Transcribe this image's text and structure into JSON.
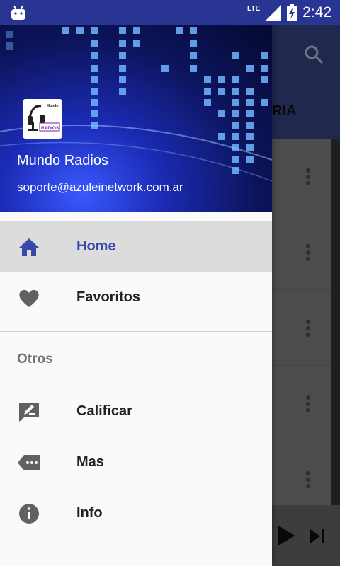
{
  "status_bar": {
    "network": "LTE",
    "time": "2:42"
  },
  "background_app": {
    "tab_fragment": "RIA"
  },
  "drawer": {
    "header": {
      "logo_text_top": "Mundo",
      "logo_text_bottom": "RADIOS",
      "name": "Mundo Radios",
      "email": "soporte@azuleinetwork.com.ar"
    },
    "items": [
      {
        "label": "Home",
        "icon": "home-icon",
        "active": true
      },
      {
        "label": "Favoritos",
        "icon": "heart-icon",
        "active": false
      }
    ],
    "section_title": "Otros",
    "other_items": [
      {
        "label": "Calificar",
        "icon": "rate-review-icon"
      },
      {
        "label": "Mas",
        "icon": "more-tag-icon"
      },
      {
        "label": "Info",
        "icon": "info-icon"
      }
    ]
  },
  "colors": {
    "accent": "#3949ab",
    "statusbar": "#283593"
  }
}
